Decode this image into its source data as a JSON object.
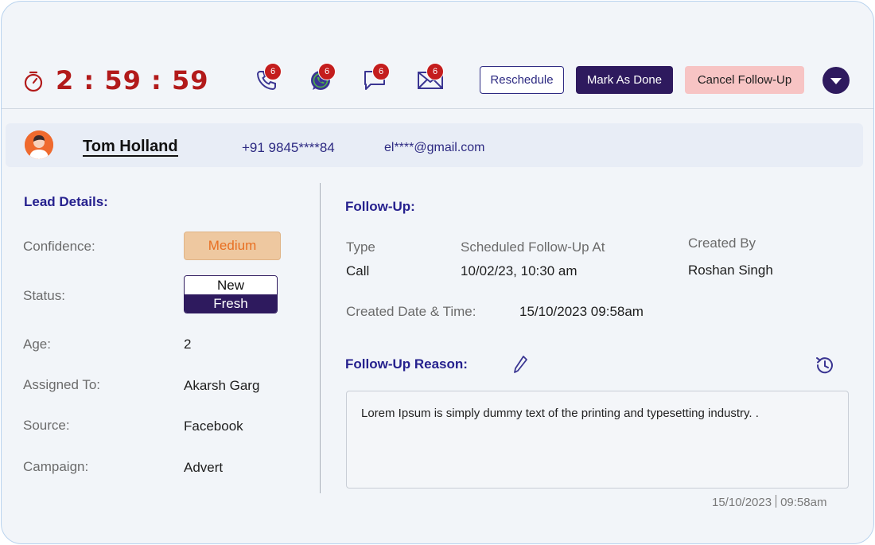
{
  "timer": {
    "display": "2 : 59 : 59",
    "ghost": "59"
  },
  "channels": [
    {
      "name": "call",
      "count": "6"
    },
    {
      "name": "whatsapp",
      "count": "6"
    },
    {
      "name": "sms",
      "count": "6"
    },
    {
      "name": "email",
      "count": "6"
    }
  ],
  "actions": {
    "reschedule": "Reschedule",
    "mark_done": "Mark As Done",
    "cancel": "Cancel Follow-Up"
  },
  "contact": {
    "name": "Tom Holland",
    "phone": "+91 9845****84",
    "email": "el****@gmail.com"
  },
  "lead": {
    "title": "Lead Details:",
    "confidence_label": "Confidence:",
    "confidence_value": "Medium",
    "status_label": "Status:",
    "status_top": "New",
    "status_bottom": "Fresh",
    "age_label": "Age:",
    "age_value": "2",
    "assigned_label": "Assigned To:",
    "assigned_value": "Akarsh Garg",
    "source_label": "Source:",
    "source_value": "Facebook",
    "campaign_label": "Campaign:",
    "campaign_value": "Advert"
  },
  "followup": {
    "title": "Follow-Up:",
    "type_label": "Type",
    "type_value": "Call",
    "scheduled_label": "Scheduled Follow-Up At",
    "scheduled_value": "10/02/23, 10:30 am",
    "created_by_label": "Created By",
    "created_by_value": "Roshan Singh",
    "created_dt_label": "Created Date & Time:",
    "created_dt_value": "15/10/2023 09:58am",
    "reason_title": "Follow-Up Reason:",
    "reason_text": "Lorem Ipsum is simply dummy text of the printing and typesetting industry. .",
    "stamp_date": "15/10/2023",
    "stamp_time": "09:58am"
  },
  "colors": {
    "timer": "#b21a1a",
    "brand": "#2e1a5e",
    "link": "#26218e",
    "cancel_bg": "#f7c4c4",
    "medium_bg": "#eec8a0"
  }
}
